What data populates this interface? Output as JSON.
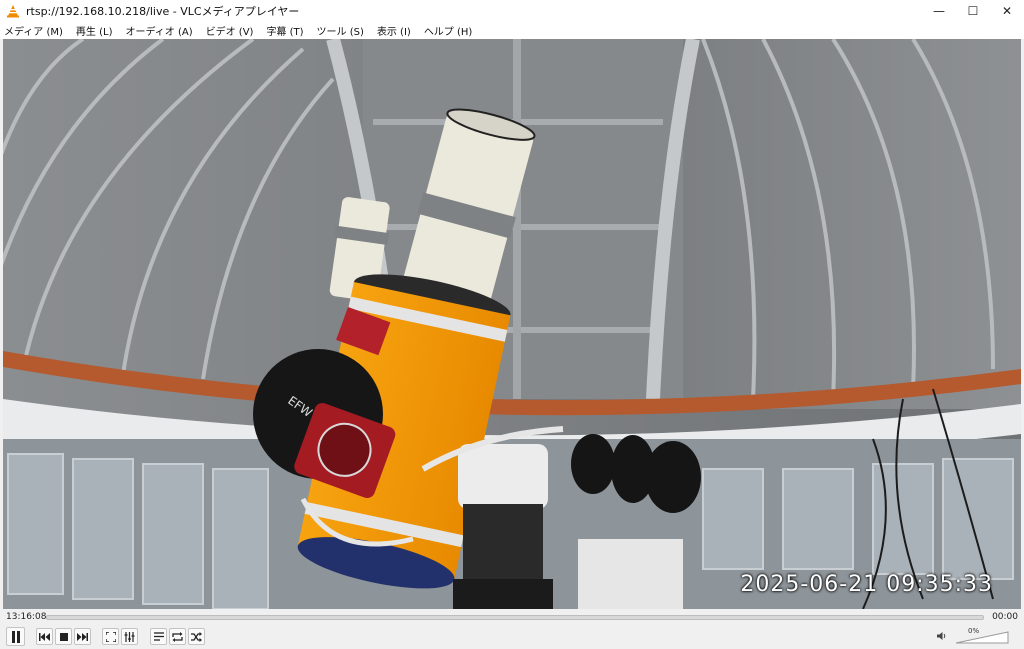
{
  "window": {
    "title": "rtsp://192.168.10.218/live - VLCメディアプレイヤー",
    "minimize_glyph": "—",
    "maximize_glyph": "☐",
    "close_glyph": "✕",
    "app_icon": "vlc-cone-icon",
    "accent_color": "#f28a00"
  },
  "menu": {
    "items": [
      {
        "label": "メディア (M)"
      },
      {
        "label": "再生 (L)"
      },
      {
        "label": "オーディオ (A)"
      },
      {
        "label": "ビデオ (V)"
      },
      {
        "label": "字幕 (T)"
      },
      {
        "label": "ツール (S)"
      },
      {
        "label": "表示 (I)"
      },
      {
        "label": "ヘルプ (H)"
      }
    ]
  },
  "video": {
    "overlay_timestamp": "2025-06-21  09:35:33"
  },
  "playback": {
    "elapsed": "13:16:08",
    "total": "00:00",
    "progress": 0
  },
  "controls": {
    "buttons": [
      "pause-icon",
      "previous-icon",
      "stop-icon",
      "next-icon",
      "fullscreen-icon",
      "extended-settings-icon",
      "playlist-icon",
      "loop-icon",
      "shuffle-icon"
    ]
  },
  "volume": {
    "label": "0%",
    "level": 0,
    "icon": "speaker-icon"
  }
}
